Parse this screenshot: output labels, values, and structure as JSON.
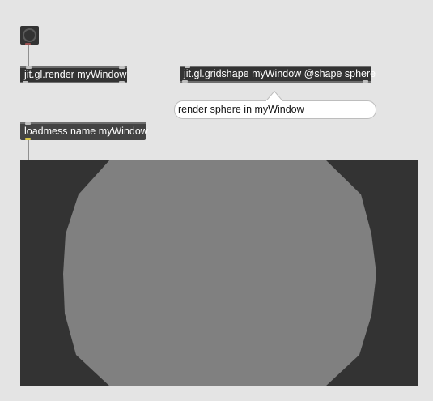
{
  "patcher": {
    "background": "#e4e4e4"
  },
  "objects": {
    "toggle": {
      "label": ""
    },
    "render": {
      "text": "jit.gl.render myWindow"
    },
    "gridshape": {
      "text": "jit.gl.gridshape myWindow @shape sphere"
    },
    "loadmess": {
      "text": "loadmess name myWindow"
    }
  },
  "comment": {
    "text": "render sphere in myWindow"
  },
  "jit_window": {
    "background": "#333333",
    "shape": "sphere",
    "shape_color": "#808080"
  }
}
